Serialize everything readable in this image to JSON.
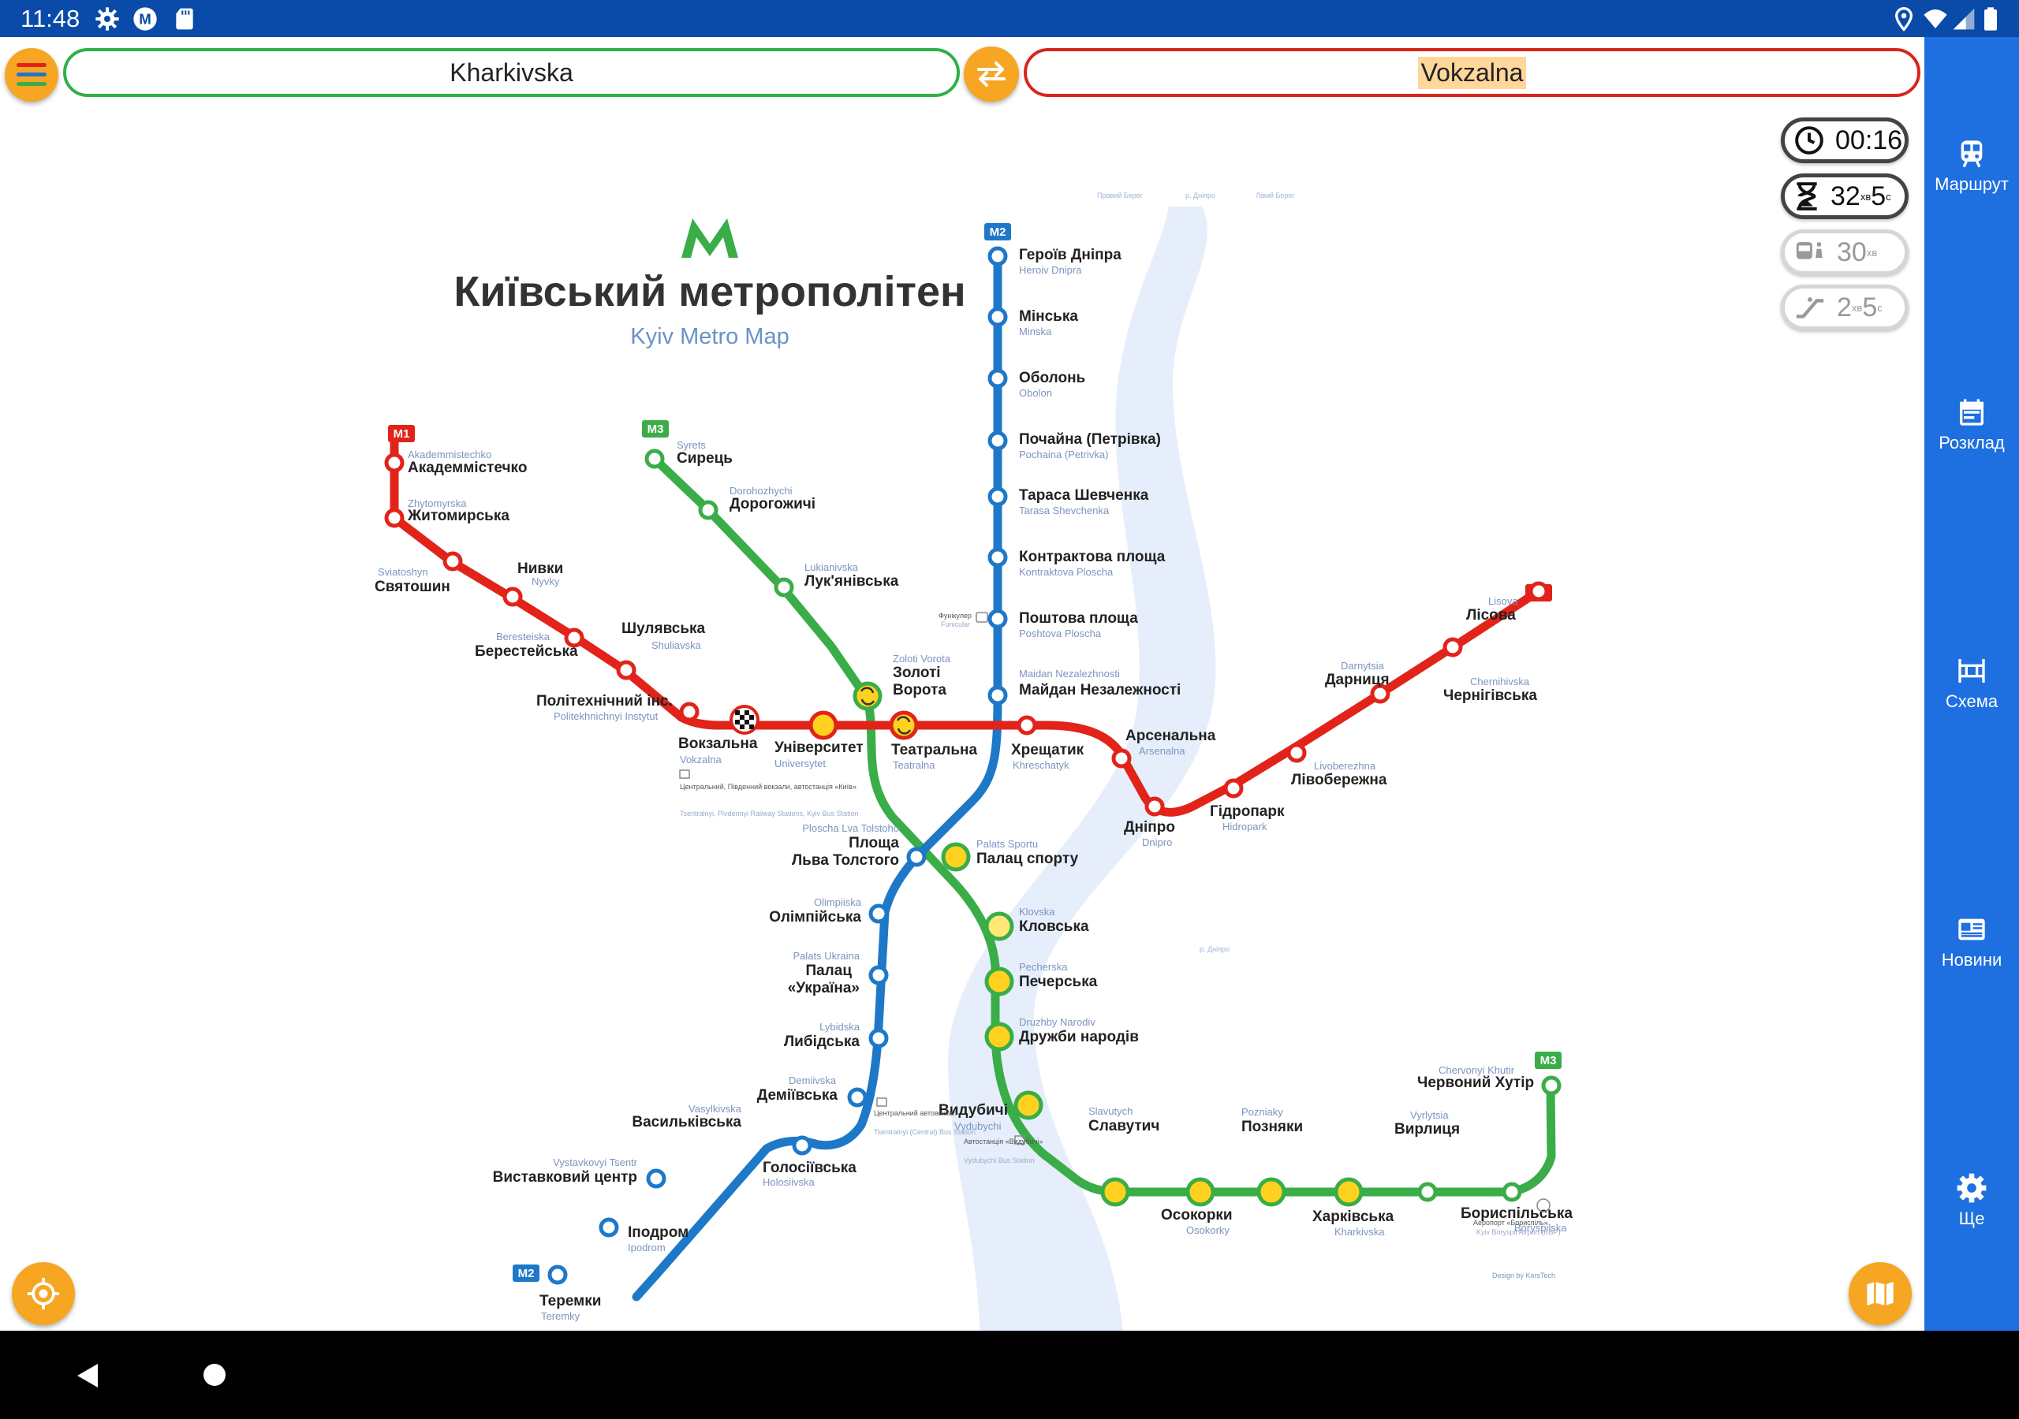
{
  "status_bar": {
    "time": "11:48",
    "icons": [
      "gear-icon",
      "metro-logo-icon",
      "sd-card-icon",
      "location-icon",
      "wifi-icon",
      "signal-icon",
      "battery-icon"
    ]
  },
  "search": {
    "from_value": "Kharkivska",
    "to_value": "Vokzalna",
    "from_color": "#2fb04a",
    "to_color": "#d8251a"
  },
  "route_stats": {
    "travel_time": "00:16",
    "duration_main": "32",
    "duration_unit1": "хв",
    "duration_sec": "5",
    "duration_unit2": "с",
    "train_wait": "30",
    "train_wait_unit": "хв",
    "transfer_main": "2",
    "transfer_unit1": "хв",
    "transfer_sec": "5",
    "transfer_unit2": "с"
  },
  "rail": {
    "items": [
      {
        "label": "Маршрут",
        "icon": "train-icon"
      },
      {
        "label": "Розклад",
        "icon": "calendar-icon"
      },
      {
        "label": "Схема",
        "icon": "scheme-icon"
      },
      {
        "label": "Новини",
        "icon": "news-icon"
      },
      {
        "label": "Ще",
        "icon": "gear-icon"
      }
    ]
  },
  "map": {
    "title": "Київський метрополітен",
    "subtitle": "Kyiv Metro Map",
    "credit": "Design by KorsTech",
    "line_badges": {
      "m1": "M1",
      "m2": "M2",
      "m3": "M3"
    },
    "colors": {
      "m1": "#e2231a",
      "m2": "#1e78c8",
      "m3": "#3aad48",
      "river": "#e6eefb",
      "route": "#ffd21f"
    },
    "river_labels": {
      "a": "Правий Берег",
      "b": "р. Дніпро",
      "c": "Лівий Берег",
      "d": "р. Дніпро"
    },
    "station_notes": {
      "vokzalna": "Центральний, Південний вокзали, автостанція «Київ»",
      "vokzalna_en": "Tsentralnyi, Pivdennyi Railway Stations, Kyiv Bus Station",
      "funicular": "Фунікулер",
      "funicular_en": "Funicular",
      "demiivska": "Центральний автовокзал",
      "demiivska_en": "Tsentralnyi (Central) Bus Station",
      "vydubychi": "Автостанція «Видубичі»",
      "vydubychi_en": "Vydubychi Bus Station",
      "airport": "Аеропорт «Бориспіль»",
      "airport_en": "Kyiv Boryspil Airport (KBP)"
    },
    "stations": {
      "akademmistechko": {
        "ua": "Академмістечко",
        "en": "Akademmistechko"
      },
      "zhytomyrska": {
        "ua": "Житомирська",
        "en": "Zhytomyrska"
      },
      "sviatoshyn": {
        "ua": "Святошин",
        "en": "Sviatoshyn"
      },
      "nyvky": {
        "ua": "Нивки",
        "en": "Nyvky"
      },
      "beresteiska": {
        "ua": "Берестейська",
        "en": "Beresteiska"
      },
      "shuliavska": {
        "ua": "Шулявська",
        "en": "Shuliavska"
      },
      "politekhnichnyi": {
        "ua": "Політехнічний інс.",
        "en": "Politekhnichnyi Instytut"
      },
      "vokzalna": {
        "ua": "Вокзальна",
        "en": "Vokzalna"
      },
      "universytet": {
        "ua": "Університет",
        "en": "Universytet"
      },
      "teatralna": {
        "ua": "Театральна",
        "en": "Teatralna"
      },
      "khreshchatyk": {
        "ua": "Хрещатик",
        "en": "Khreschatyk"
      },
      "arsenalna": {
        "ua": "Арсенальна",
        "en": "Arsenalna"
      },
      "dnipro": {
        "ua": "Дніпро",
        "en": "Dnipro"
      },
      "hidropark": {
        "ua": "Гідропарк",
        "en": "Hidropark"
      },
      "livoberezhna": {
        "ua": "Лівобережна",
        "en": "Livoberezhna"
      },
      "darnytsia": {
        "ua": "Дарниця",
        "en": "Darnytsia"
      },
      "chernihivska": {
        "ua": "Чернігівська",
        "en": "Chernihivska"
      },
      "lisova": {
        "ua": "Лісова",
        "en": "Lisova"
      },
      "heroiv_dnipra": {
        "ua": "Героїв Дніпра",
        "en": "Heroiv Dnipra"
      },
      "minska": {
        "ua": "Мінська",
        "en": "Minska"
      },
      "obolon": {
        "ua": "Оболонь",
        "en": "Obolon"
      },
      "pochaina": {
        "ua": "Почайна (Петрівка)",
        "en": "Pochaina (Petrivka)"
      },
      "tarasa_shevchenka": {
        "ua": "Тараса Шевченка",
        "en": "Tarasa Shevchenka"
      },
      "kontraktova": {
        "ua": "Контрактова площа",
        "en": "Kontraktova Ploscha"
      },
      "poshtova": {
        "ua": "Поштова площа",
        "en": "Poshtova Ploscha"
      },
      "maidan": {
        "ua": "Майдан Незалежності",
        "en": "Maidan Nezalezhnosti"
      },
      "ploshcha_lva_1": {
        "ua": "Площа",
        "en": "Ploscha Lva Tolstoho"
      },
      "ploshcha_lva_2": {
        "ua": "Льва Толстого",
        "en": ""
      },
      "olimpiiska": {
        "ua": "Олімпійська",
        "en": "Olimpiiska"
      },
      "palats_ukraina_1": {
        "ua": "Палац",
        "en": "Palats Ukraina"
      },
      "palats_ukraina_2": {
        "ua": "«Україна»",
        "en": ""
      },
      "lybidska": {
        "ua": "Либідська",
        "en": "Lybidska"
      },
      "demiivska": {
        "ua": "Деміївська",
        "en": "Demiivska"
      },
      "holosiivska": {
        "ua": "Голосіївська",
        "en": "Holosiivska"
      },
      "vasylkivska": {
        "ua": "Васильківська",
        "en": "Vasylkivska"
      },
      "vystavkovyi": {
        "ua": "Виставковий центр",
        "en": "Vystavkovyi Tsentr"
      },
      "ipodrom": {
        "ua": "Іподром",
        "en": "Ipodrom"
      },
      "teremky": {
        "ua": "Теремки",
        "en": "Teremky"
      },
      "syrets": {
        "ua": "Сирець",
        "en": "Syrets"
      },
      "dorohozhychi": {
        "ua": "Дорогожичі",
        "en": "Dorohozhychi"
      },
      "lukianivska": {
        "ua": "Лук'янівська",
        "en": "Lukianivska"
      },
      "zoloti_vorota_1": {
        "ua": "Золоті",
        "en": "Zoloti Vorota"
      },
      "zoloti_vorota_2": {
        "ua": "Ворота",
        "en": ""
      },
      "palats_sportu": {
        "ua": "Палац спорту",
        "en": "Palats Sportu"
      },
      "klovska": {
        "ua": "Кловська",
        "en": "Klovska"
      },
      "pecherska": {
        "ua": "Печерська",
        "en": "Pecherska"
      },
      "druzhby_narodiv": {
        "ua": "Дружби народів",
        "en": "Druzhby Narodiv"
      },
      "vydubychi": {
        "ua": "Видубичі",
        "en": "Vydubychi"
      },
      "slavutych": {
        "ua": "Славутич",
        "en": "Slavutych"
      },
      "osokorky": {
        "ua": "Осокорки",
        "en": "Osokorky"
      },
      "pozniaky": {
        "ua": "Позняки",
        "en": "Pozniaky"
      },
      "kharkivska": {
        "ua": "Харківська",
        "en": "Kharkivska"
      },
      "vyrlytsia": {
        "ua": "Вирлиця",
        "en": "Vyrlytsia"
      },
      "boryspilska": {
        "ua": "Бориспільська",
        "en": "Boryspilska"
      },
      "chervonyi_khutir": {
        "ua": "Червоний Хутір",
        "en": "Chervonyi Khutir"
      }
    }
  }
}
